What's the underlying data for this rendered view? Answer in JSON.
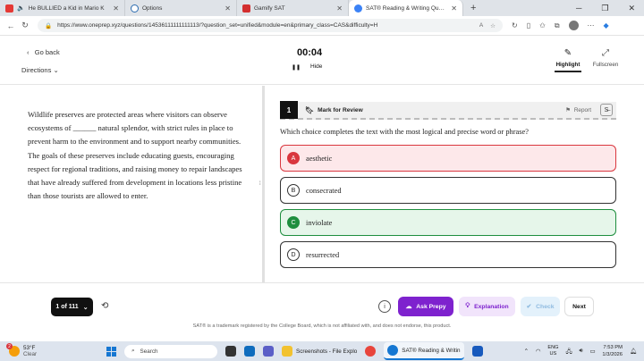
{
  "browser": {
    "tabs": [
      {
        "title": "He BULLIED a Kid in Mario K",
        "fav_color": "#e53935",
        "active": false
      },
      {
        "title": "Options",
        "fav_color": "#2b6cb0",
        "active": false
      },
      {
        "title": "Gamify SAT",
        "fav_color": "#d32f2f",
        "active": false
      },
      {
        "title": "SAT® Reading & Writing Questio",
        "fav_color": "#3b82f6",
        "active": true
      }
    ],
    "url": "https://www.oneprep.xyz/questions/14536111111111113/?question_set=unified&module=en&primary_class=CAS&difficulty=H"
  },
  "header": {
    "go_back": "Go back",
    "directions": "Directions",
    "timer": "00:04",
    "hide": "Hide",
    "highlight": "Highlight",
    "fullscreen": "Fullscreen"
  },
  "passage": "Wildlife preserves are protected areas where visitors can observe ecosystems of ______ natural splendor, with strict rules in place to prevent harm to the environment and to support nearby communities. The goals of these preserves include educating guests, encouraging respect for regional traditions, and raising money to repair landscapes that have already suffered from development in locations less pristine than those tourists are allowed to enter.",
  "question": {
    "number": "1",
    "mark_for_review": "Mark for Review",
    "report": "Report",
    "text": "Which choice completes the text with the most logical and precise word or phrase?",
    "choices": [
      {
        "letter": "A",
        "text": "aesthetic",
        "state": "incorrect"
      },
      {
        "letter": "B",
        "text": "consecrated",
        "state": "none"
      },
      {
        "letter": "C",
        "text": "inviolate",
        "state": "correct"
      },
      {
        "letter": "D",
        "text": "resurrected",
        "state": "none"
      }
    ]
  },
  "footer": {
    "question_count": "1 of 111",
    "ask_prepy": "Ask Prepy",
    "explanation": "Explanation",
    "check": "Check",
    "next": "Next",
    "disclaimer": "SAT® is a trademark registered by the College Board, which is not affiliated with, and does not endorse, this product."
  },
  "taskbar": {
    "weather_temp": "53°F",
    "weather_desc": "Clear",
    "badge": "2",
    "search": "Search",
    "apps": [
      {
        "label": "Screenshots - File Explo",
        "color": "#f2c230"
      },
      {
        "label": "SAT® Reading & Writin",
        "color": "#1677d2"
      }
    ],
    "lang_top": "ENG",
    "lang_bottom": "US",
    "time": "7:53 PM",
    "date": "1/3/2026"
  },
  "colors": {
    "incorrect": "#d9363e",
    "correct": "#1e8e3e",
    "accent_purple": "#7e22ce"
  }
}
